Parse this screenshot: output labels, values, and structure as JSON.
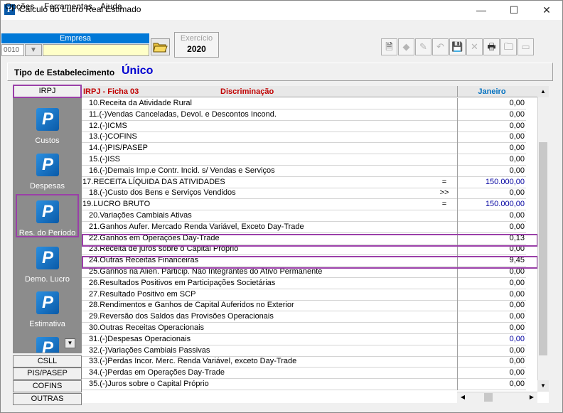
{
  "window": {
    "title": "Cálculo do Lucro Real Estimado",
    "app_icon_letter": "P",
    "minimize": "—",
    "maximize": "☐",
    "close": "✕"
  },
  "menu": {
    "items": [
      "Opções",
      "Ferramentas",
      "Ajuda"
    ]
  },
  "toolbar": {
    "empresa_label": "Empresa",
    "empresa_code": "0010",
    "empresa_name": "",
    "exercicio_label": "Exercício",
    "exercicio_value": "2020",
    "buttons": [
      {
        "icon": "document-icon",
        "glyph": "🗎",
        "enabled": true
      },
      {
        "icon": "diamond-icon",
        "glyph": "◆",
        "enabled": false
      },
      {
        "icon": "tools-icon",
        "glyph": "✎",
        "enabled": false
      },
      {
        "icon": "undo-icon",
        "glyph": "↶",
        "enabled": false
      },
      {
        "icon": "save-icon",
        "glyph": "💾",
        "enabled": true
      },
      {
        "icon": "delete-icon",
        "glyph": "✕",
        "enabled": false
      },
      {
        "icon": "print-icon",
        "glyph": "🖶",
        "enabled": true
      },
      {
        "icon": "folders-icon",
        "glyph": "🗀",
        "enabled": true
      },
      {
        "icon": "window-icon",
        "glyph": "▭",
        "enabled": false
      }
    ]
  },
  "estabelecimento": {
    "label": "Tipo de Estabelecimento",
    "value": "Único"
  },
  "side": {
    "top_tab": "IRPJ",
    "modules": [
      {
        "label": "Custos"
      },
      {
        "label": "Despesas"
      },
      {
        "label": "Res. do Período"
      },
      {
        "label": "Demo. Lucro"
      },
      {
        "label": "Estimativa"
      },
      {
        "label": ""
      }
    ],
    "bottom_tabs": [
      "CSLL",
      "PIS/PASEP",
      "COFINS",
      "OUTRAS"
    ]
  },
  "grid": {
    "ficha": "IRPJ - Ficha  03",
    "discriminacao": "Discriminação",
    "month": "Janeiro",
    "rows": [
      {
        "desc": "10.Receita da Atividade Rural",
        "indent": true,
        "op": "",
        "val": "0,00",
        "blue": false
      },
      {
        "desc": "11.(-)Vendas Canceladas, Devol. e Descontos Incond.",
        "indent": true,
        "op": "",
        "val": "0,00",
        "blue": false
      },
      {
        "desc": "12.(-)ICMS",
        "indent": true,
        "op": "",
        "val": "0,00",
        "blue": false
      },
      {
        "desc": "13.(-)COFINS",
        "indent": true,
        "op": "",
        "val": "0,00",
        "blue": false
      },
      {
        "desc": "14.(-)PIS/PASEP",
        "indent": true,
        "op": "",
        "val": "0,00",
        "blue": false
      },
      {
        "desc": "15.(-)ISS",
        "indent": true,
        "op": "",
        "val": "0,00",
        "blue": false
      },
      {
        "desc": "16.(-)Demais Imp.e Contr. Incid. s/ Vendas e Serviços",
        "indent": true,
        "op": "",
        "val": "0,00",
        "blue": false
      },
      {
        "desc": "17.RECEITA LÍQUIDA DAS ATIVIDADES",
        "indent": false,
        "op": "=",
        "val": "150.000,00",
        "blue": true
      },
      {
        "desc": "18.(-)Custo dos Bens e Serviços Vendidos",
        "indent": true,
        "op": ">>",
        "val": "0,00",
        "blue": false
      },
      {
        "desc": "19.LUCRO BRUTO",
        "indent": false,
        "op": "=",
        "val": "150.000,00",
        "blue": true
      },
      {
        "desc": "20.Variações Cambiais Ativas",
        "indent": true,
        "op": "",
        "val": "0,00",
        "blue": false
      },
      {
        "desc": "21.Ganhos Aufer. Mercado Renda Variável, Exceto Day-Trade",
        "indent": true,
        "op": "",
        "val": "0,00",
        "blue": false
      },
      {
        "desc": "22.Ganhos em Operações Day-Trade",
        "indent": true,
        "op": "",
        "val": "0,13",
        "blue": false
      },
      {
        "desc": "23.Receita de juros sobre o Capital Próprio",
        "indent": true,
        "op": "",
        "val": "0,00",
        "blue": false
      },
      {
        "desc": "24.Outras Receitas Financeiras",
        "indent": true,
        "op": "",
        "val": "9,45",
        "blue": false
      },
      {
        "desc": "25.Ganhos na Alien. Particip. Não Integrantes do Ativo Permanente",
        "indent": true,
        "op": "",
        "val": "0,00",
        "blue": false
      },
      {
        "desc": "26.Resultados Positivos em Participações Societárias",
        "indent": true,
        "op": "",
        "val": "0,00",
        "blue": false
      },
      {
        "desc": "27.Resultado Positivo em SCP",
        "indent": true,
        "op": "",
        "val": "0,00",
        "blue": false
      },
      {
        "desc": "28.Rendimentos e Ganhos de Capital Auferidos no Exterior",
        "indent": true,
        "op": "",
        "val": "0,00",
        "blue": false
      },
      {
        "desc": "29.Reversão dos Saldos das Provisões Operacionais",
        "indent": true,
        "op": "",
        "val": "0,00",
        "blue": false
      },
      {
        "desc": "30.Outras Receitas Operacionais",
        "indent": true,
        "op": "",
        "val": "0,00",
        "blue": false
      },
      {
        "desc": "31.(-)Despesas Operacionais",
        "indent": true,
        "op": "",
        "val": "0,00",
        "blue": true
      },
      {
        "desc": "32.(-)Variações Cambiais Passivas",
        "indent": true,
        "op": "",
        "val": "0,00",
        "blue": false
      },
      {
        "desc": "33.(-)Perdas Incor. Merc. Renda Variável, exceto Day-Trade",
        "indent": true,
        "op": "",
        "val": "0,00",
        "blue": false
      },
      {
        "desc": "34.(-)Perdas em Operações Day-Trade",
        "indent": true,
        "op": "",
        "val": "0,00",
        "blue": false
      },
      {
        "desc": "35.(-)Juros sobre o Capital Próprio",
        "indent": true,
        "op": "",
        "val": "0,00",
        "blue": false
      }
    ]
  },
  "colors": {
    "accent": "#0078d7",
    "highlight": "#9a3fa8",
    "header_red": "#c00000",
    "value_blue": "#0000a0"
  }
}
